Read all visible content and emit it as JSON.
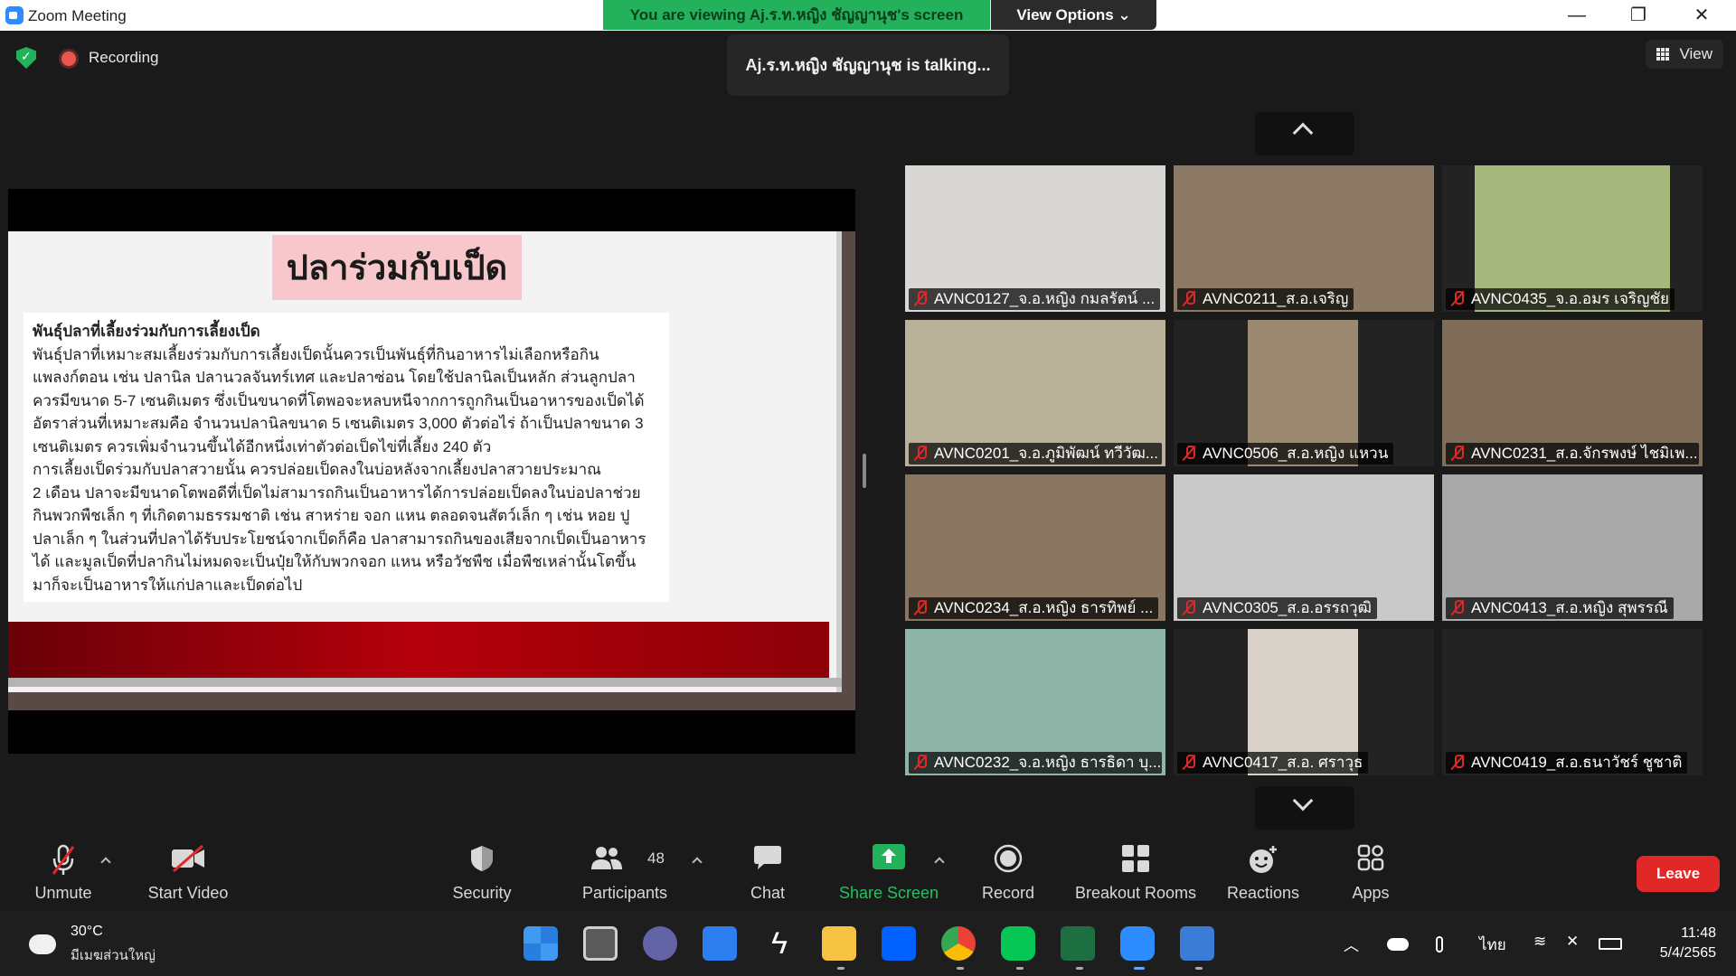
{
  "window": {
    "title": "Zoom Meeting",
    "viewing_banner": "You are viewing Aj.ร.ท.หญิง ชัญญานุช's screen",
    "view_options": "View Options ⌄",
    "minimize": "—",
    "restore": "❐",
    "close": "✕"
  },
  "meeting": {
    "recording_label": "Recording",
    "talking_indicator": "Aj.ร.ท.หญิง ชัญญานุช is  talking...",
    "view_label": "View"
  },
  "slide": {
    "title": "ปลาร่วมกับเป็ด",
    "heading": "พันธุ์ปลาที่เลี้ยงร่วมกับการเลี้ยงเป็ด",
    "lines": [
      "พันธุ์ปลาที่เหมาะสมเลี้ยงร่วมกับการเลี้ยงเป็ดนั้นควรเป็นพันธุ์ที่กินอาหารไม่เลือกหรือกิน",
      "แพลงก์ตอน เช่น ปลานิล ปลานวลจันทร์เทศ และปลาซ่อน โดยใช้ปลานิลเป็นหลัก ส่วนลูกปลา",
      "ควรมีขนาด 5-7 เซนติเมตร ซึ่งเป็นขนาดที่โตพอจะหลบหนีจากการถูกกินเป็นอาหารของเป็ดได้",
      "อัตราส่วนที่เหมาะสมคือ จำนวนปลานิลขนาด 5 เซนติเมตร 3,000 ตัวต่อไร่ ถ้าเป็นปลาขนาด 3",
      "เซนติเมตร ควรเพิ่มจำนวนขึ้นได้อีกหนึ่งเท่าตัวต่อเป็ดไข่ที่เลี้ยง 240 ตัว",
      "การเลี้ยงเป็ดร่วมกับปลาสวายนั้น ควรปล่อยเป็ดลงในบ่อหลังจากเลี้ยงปลาสวายประมาณ",
      "2 เดือน ปลาจะมีขนาดโตพอดีที่เป็ดไม่สามารถกินเป็นอาหารได้การปล่อยเป็ดลงในบ่อปลาช่วย",
      "กินพวกพืชเล็ก ๆ ที่เกิดตามธรรมชาติ เช่น สาหร่าย จอก แหน ตลอดจนสัตว์เล็ก ๆ เช่น หอย ปู",
      "ปลาเล็ก ๆ ในส่วนที่ปลาได้รับประโยชน์จากเป็ดก็คือ ปลาสามารถกินของเสียจากเป็ดเป็นอาหาร",
      "ได้ และมูลเป็ดที่ปลากินไม่หมดจะเป็นปุ๋ยให้กับพวกจอก แหน หรือวัชพืช เมื่อพืชเหล่านั้นโตขึ้น",
      "มาก็จะเป็นอาหารให้แก่ปลาและเป็ดต่อไป"
    ]
  },
  "participants": [
    {
      "name": "AVNC0127_จ.อ.หญิง กมลรัตน์ ...",
      "video": "#d9d7d4"
    },
    {
      "name": "AVNC0211_ส.อ.เจริญ",
      "video": "#8d7a66"
    },
    {
      "name": "AVNC0435_จ.อ.อมร  เจริญชัย",
      "video": "#a6b87d"
    },
    {
      "name": "AVNC0201_จ.อ.ภูมิพัฒน์ ทวีวัฒ...",
      "video": "#b9b09a"
    },
    {
      "name": "AVNC0506_ส.อ.หญิง แหวน",
      "video": "#9c8a70"
    },
    {
      "name": "AVNC0231_ส.อ.จักรพงษ์ ไชมิเพ...",
      "video": "#7f6d5a"
    },
    {
      "name": "AVNC0234_ส.อ.หญิง ธารทิพย์ ...",
      "video": "#8a7560"
    },
    {
      "name": "AVNC0305_ส.อ.อรรถวุฒิ",
      "video": "#c9c9c9"
    },
    {
      "name": "AVNC0413_ส.อ.หญิง สุพรรณี",
      "video": "#a9a9a9"
    },
    {
      "name": "AVNC0232_จ.อ.หญิง ธารธิดา บุ...",
      "video": "#8fb5a8"
    },
    {
      "name": "AVNC0417_ส.อ. ศราวุธ",
      "video": "#d8d2c8"
    },
    {
      "name": "AVNC0419_ส.อ.ธนาวัชร์ ชูชาติ",
      "video": ""
    }
  ],
  "toolbar": {
    "unmute": "Unmute",
    "start_video": "Start Video",
    "security": "Security",
    "participants": "Participants",
    "participant_count": "48",
    "chat": "Chat",
    "share_screen": "Share Screen",
    "record": "Record",
    "breakout_rooms": "Breakout Rooms",
    "reactions": "Reactions",
    "apps": "Apps",
    "leave": "Leave"
  },
  "taskbar": {
    "temperature": "30°C",
    "condition": "มีเมฆส่วนใหญ่",
    "language": "ไทย",
    "time": "11:48",
    "date": "5/4/2565"
  },
  "colors": {
    "zoom_blue": "#2d8cff",
    "banner_green": "#23b15c",
    "leave_red": "#e02828",
    "muted_red": "#e02828"
  }
}
